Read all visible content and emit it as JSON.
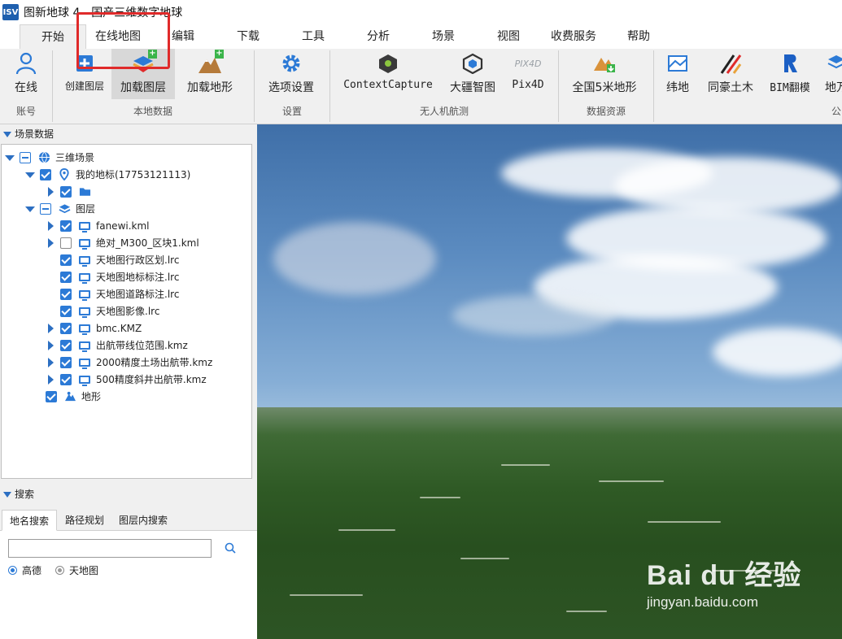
{
  "app": {
    "logo_text": "ISV",
    "title": "图新地球 4 - 国产三维数字地球"
  },
  "menu": {
    "tabs": [
      "开始",
      "在线地图",
      "编辑",
      "下载",
      "工具",
      "分析",
      "场景",
      "视图",
      "收费服务",
      "帮助"
    ],
    "active": "开始"
  },
  "ribbon": {
    "buttons": {
      "online": "在线",
      "create_layer": "创建图层",
      "load_layer": "加载图层",
      "load_terrain": "加载地形",
      "options": "选项设置",
      "context_capture": "ContextCapture",
      "dajiang": "大疆智图",
      "pix4d": "Pix4D",
      "terrain_5m": "全国5米地形",
      "weidi": "纬地",
      "tonghao": "同豪土木",
      "bim": "BIM翻模",
      "more": "地万"
    },
    "pix4d_icon_text": "PIX4D",
    "groups": {
      "account": "账号",
      "local_data": "本地数据",
      "settings": "设置",
      "uav": "无人机航测",
      "data_resources": "数据资源",
      "public": "公"
    }
  },
  "scene_panel": {
    "title": "场景数据",
    "tree": [
      {
        "label": "三维场景",
        "level": 0,
        "expander": "open",
        "check": "partial",
        "icon": "globe-icon"
      },
      {
        "label": "我的地标(17753121113)",
        "level": 1,
        "expander": "open",
        "check": "checked",
        "icon": "location-pin-icon"
      },
      {
        "label": "",
        "level": 2,
        "expander": "closed",
        "check": "checked",
        "icon": "folder-icon"
      },
      {
        "label": "图层",
        "level": 1,
        "expander": "open",
        "check": "partial",
        "icon": "layers-icon"
      },
      {
        "label": "fanewi.kml",
        "level": 2,
        "expander": "closed",
        "check": "checked",
        "icon": "monitor-icon"
      },
      {
        "label": "绝对_M300_区块1.kml",
        "level": 2,
        "expander": "closed",
        "check": "unchecked",
        "icon": "monitor-icon"
      },
      {
        "label": "天地图行政区划.lrc",
        "level": 2,
        "expander": "none",
        "check": "checked",
        "icon": "monitor-icon"
      },
      {
        "label": "天地图地标标注.lrc",
        "level": 2,
        "expander": "none",
        "check": "checked",
        "icon": "monitor-icon"
      },
      {
        "label": "天地图道路标注.lrc",
        "level": 2,
        "expander": "none",
        "check": "checked",
        "icon": "monitor-icon"
      },
      {
        "label": "天地图影像.lrc",
        "level": 2,
        "expander": "none",
        "check": "checked",
        "icon": "monitor-icon"
      },
      {
        "label": "bmc.KMZ",
        "level": 2,
        "expander": "closed",
        "check": "checked",
        "icon": "monitor-icon"
      },
      {
        "label": "出航带线位范围.kmz",
        "level": 2,
        "expander": "closed",
        "check": "checked",
        "icon": "monitor-icon"
      },
      {
        "label": "2000精度土场出航带.kmz",
        "level": 2,
        "expander": "closed",
        "check": "checked",
        "icon": "monitor-icon"
      },
      {
        "label": "500精度斜井出航带.kmz",
        "level": 2,
        "expander": "closed",
        "check": "checked",
        "icon": "monitor-icon"
      },
      {
        "label": "地形",
        "level": 1,
        "expander": "none",
        "check": "checked",
        "icon": "terrain-icon"
      }
    ]
  },
  "search_panel": {
    "title": "搜索",
    "tabs": [
      "地名搜索",
      "路径规划",
      "图层内搜索"
    ],
    "active_tab": "地名搜索",
    "input_value": "",
    "input_placeholder": "",
    "radios": [
      {
        "label": "高德",
        "selected": true
      },
      {
        "label": "天地图",
        "selected": false
      }
    ]
  },
  "watermark": {
    "logo": "Bai du 经验",
    "url": "jingyan.baidu.com"
  },
  "colors": {
    "accent": "#2c7ad6",
    "annotation": "#e02a2a"
  }
}
